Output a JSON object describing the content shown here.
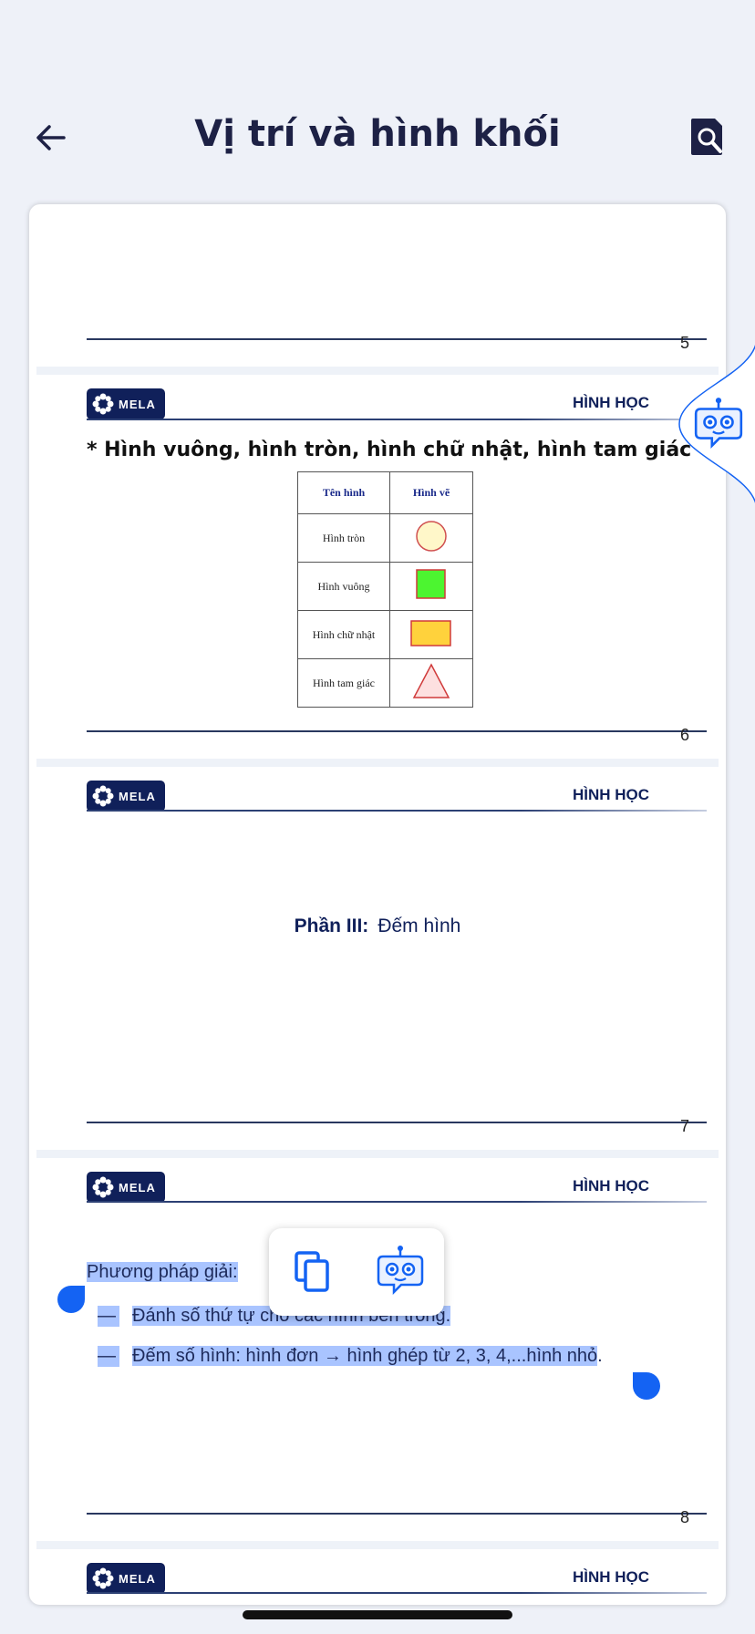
{
  "header": {
    "title": "Vị trí và hình khối"
  },
  "document": {
    "brand": "MELA",
    "section_label": "HÌNH HỌC",
    "page_numbers": [
      "5",
      "6",
      "7",
      "8"
    ],
    "page6": {
      "heading": "* Hình vuông, hình tròn, hình chữ nhật, hình tam giác",
      "table": {
        "headers": [
          "Tên hình",
          "Hình vẽ"
        ],
        "rows": [
          {
            "name": "Hình tròn",
            "shape": "circle"
          },
          {
            "name": "Hình vuông",
            "shape": "square"
          },
          {
            "name": "Hình chữ nhật",
            "shape": "rectangle"
          },
          {
            "name": "Hình tam giác",
            "shape": "triangle"
          }
        ]
      }
    },
    "page7": {
      "part_label": "Phần III:",
      "part_title": "Đếm hình"
    },
    "page8": {
      "method_title": "Phương pháp giải:",
      "bullet1": "Đánh số thứ tự cho các hình bên trong.",
      "bullet2": "Đếm số hình: hình đơn → hình ghép từ 2, 3, 4,...hình nhỏ",
      "bullet2_end": "."
    }
  },
  "colors": {
    "accent": "#1463f3",
    "brand_navy": "#10205a",
    "selection": "#a9c4ff"
  },
  "icons": [
    "back-arrow-icon",
    "search-document-icon",
    "copy-icon",
    "robot-assistant-icon"
  ]
}
